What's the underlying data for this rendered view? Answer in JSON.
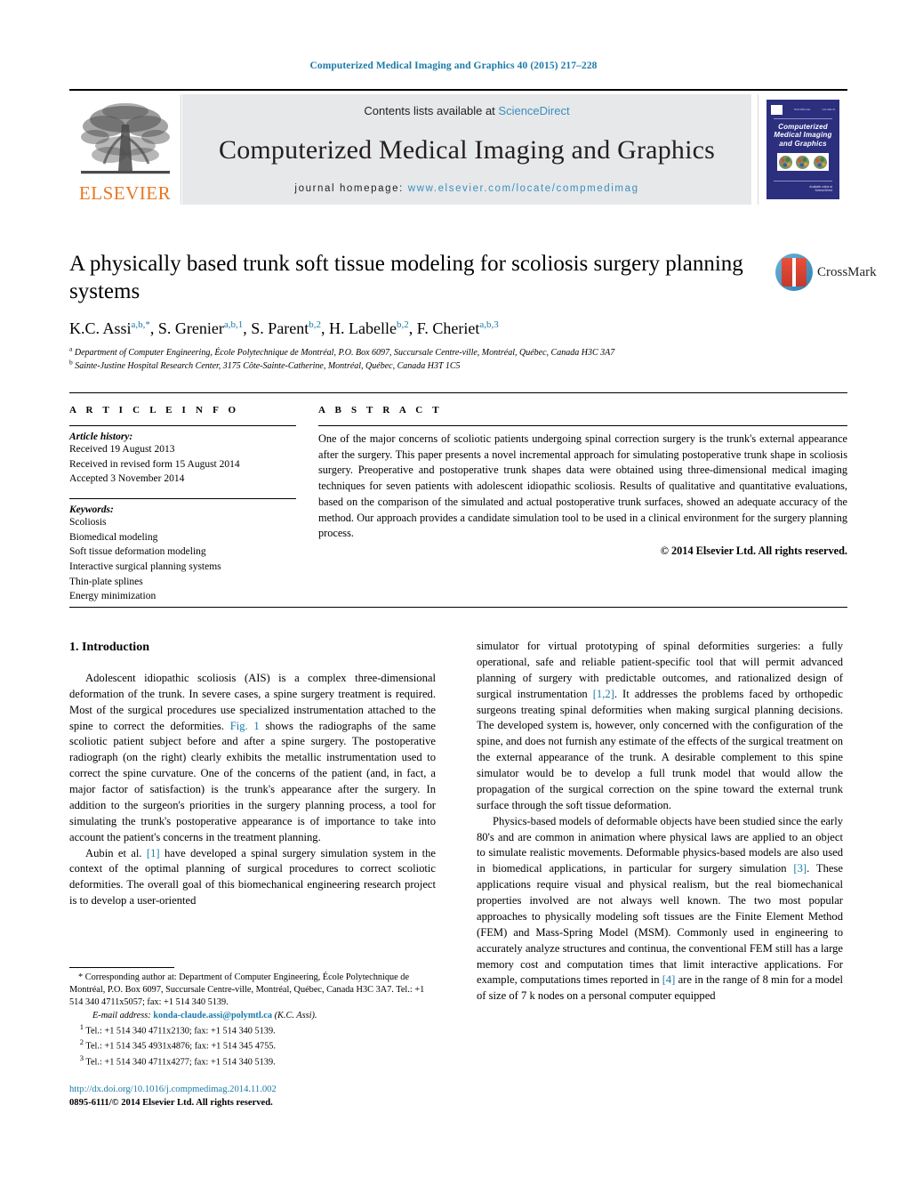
{
  "running_head": "Computerized Medical Imaging and Graphics 40 (2015) 217–228",
  "masthead": {
    "publisher_name": "ELSEVIER",
    "publisher_logo": "elsevier-tree-logo",
    "contents_prefix": "Contents lists available at ",
    "contents_link": "ScienceDirect",
    "journal_title": "Computerized Medical Imaging and Graphics",
    "homepage_label": "journal homepage:",
    "homepage_url": "www.elsevier.com/locate/compmedimag",
    "cover": {
      "title_lines": [
        "Computerized",
        "Medical Imaging",
        "and Graphics"
      ],
      "header_left": "ISSN 0895-6111",
      "header_right": "VOLUME 40",
      "footer": "Available online at\\nScienceDirect"
    }
  },
  "article": {
    "title": "A physically based trunk soft tissue modeling for scoliosis surgery planning systems",
    "authors": [
      {
        "name": "K.C. Assi",
        "sup": "a,b,*"
      },
      {
        "name": "S. Grenier",
        "sup": "a,b,1"
      },
      {
        "name": "S. Parent",
        "sup": "b,2"
      },
      {
        "name": "H. Labelle",
        "sup": "b,2"
      },
      {
        "name": "F. Cheriet",
        "sup": "a,b,3"
      }
    ],
    "affiliations": [
      {
        "mark": "a",
        "text": "Department of Computer Engineering, École Polytechnique de Montréal, P.O. Box 6097, Succursale Centre-ville, Montréal, Québec, Canada H3C 3A7"
      },
      {
        "mark": "b",
        "text": "Sainte-Justine Hospital Research Center, 3175 Côte-Sainte-Catherine, Montréal, Québec, Canada H3T 1C5"
      }
    ],
    "crossmark_label": "CrossMark"
  },
  "info": {
    "heading": "A R T I C L E    I N F O",
    "history_label": "Article history:",
    "history": [
      "Received 19 August 2013",
      "Received in revised form 15 August 2014",
      "Accepted 3 November 2014"
    ],
    "keywords_label": "Keywords:",
    "keywords": [
      "Scoliosis",
      "Biomedical modeling",
      "Soft tissue deformation modeling",
      "Interactive surgical planning systems",
      "Thin-plate splines",
      "Energy minimization"
    ]
  },
  "abstract": {
    "heading": "A B S T R A C T",
    "text": "One of the major concerns of scoliotic patients undergoing spinal correction surgery is the trunk's external appearance after the surgery. This paper presents a novel incremental approach for simulating postoperative trunk shape in scoliosis surgery. Preoperative and postoperative trunk shapes data were obtained using three-dimensional medical imaging techniques for seven patients with adolescent idiopathic scoliosis. Results of qualitative and quantitative evaluations, based on the comparison of the simulated and actual postoperative trunk surfaces, showed an adequate accuracy of the method. Our approach provides a candidate simulation tool to be used in a clinical environment for the surgery planning process.",
    "copyright": "© 2014 Elsevier Ltd. All rights reserved."
  },
  "body": {
    "section_heading": "1. Introduction",
    "left_paragraphs": [
      {
        "parts": [
          {
            "t": "Adolescent idiopathic scoliosis (AIS) is a complex three-dimensional deformation of the trunk. In severe cases, a spine surgery treatment is required. Most of the surgical procedures use specialized instrumentation attached to the spine to correct the deformities. "
          },
          {
            "t": "Fig. 1",
            "link": true
          },
          {
            "t": " shows the radiographs of the same scoliotic patient subject before and after a spine surgery. The postoperative radiograph (on the right) clearly exhibits the metallic instrumentation used to correct the spine curvature. One of the concerns of the patient (and, in fact, a major factor of satisfaction) is the trunk's appearance after the surgery. In addition to the surgeon's priorities in the surgery planning process, a tool for simulating the trunk's postoperative appearance is of importance to take into account the patient's concerns in the treatment planning."
          }
        ]
      },
      {
        "parts": [
          {
            "t": "Aubin et al. "
          },
          {
            "t": "[1]",
            "link": true
          },
          {
            "t": " have developed a spinal surgery simulation system in the context of the optimal planning of surgical procedures to correct scoliotic deformities. The overall goal of this biomechanical engineering research project is to develop a user-oriented"
          }
        ]
      }
    ],
    "right_paragraphs": [
      {
        "noindent": true,
        "parts": [
          {
            "t": "simulator for virtual prototyping of spinal deformities surgeries: a fully operational, safe and reliable patient-specific tool that will permit advanced planning of surgery with predictable outcomes, and rationalized design of surgical instrumentation "
          },
          {
            "t": "[1,2]",
            "link": true
          },
          {
            "t": ". It addresses the problems faced by orthopedic surgeons treating spinal deformities when making surgical planning decisions. The developed system is, however, only concerned with the configuration of the spine, and does not furnish any estimate of the effects of the surgical treatment on the external appearance of the trunk. A desirable complement to this spine simulator would be to develop a full trunk model that would allow the propagation of the surgical correction on the spine toward the external trunk surface through the soft tissue deformation."
          }
        ]
      },
      {
        "parts": [
          {
            "t": "Physics-based models of deformable objects have been studied since the early 80's and are common in animation where physical laws are applied to an object to simulate realistic movements. Deformable physics-based models are also used in biomedical applications, in particular for surgery simulation "
          },
          {
            "t": "[3]",
            "link": true
          },
          {
            "t": ". These applications require visual and physical realism, but the real biomechanical properties involved are not always well known. The two most popular approaches to physically modeling soft tissues are the Finite Element Method (FEM) and Mass-Spring Model (MSM). Commonly used in engineering to accurately analyze structures and continua, the conventional FEM still has a large memory cost and computation times that limit interactive applications. For example, computations times reported in "
          },
          {
            "t": "[4]",
            "link": true
          },
          {
            "t": " are in the range of 8 min for a model of size of 7 k nodes on a personal computer equipped"
          }
        ]
      }
    ]
  },
  "footnotes": {
    "corresponding": "* Corresponding author at: Department of Computer Engineering, École Polytechnique de Montréal, P.O. Box 6097, Succursale Centre-ville, Montréal, Québec, Canada H3C 3A7. Tel.: +1 514 340 4711x5057; fax: +1 514 340 5139.",
    "email_label": "E-mail address:",
    "email": "konda-claude.assi@polymtl.ca",
    "email_owner": "(K.C. Assi).",
    "numbered": [
      {
        "mark": "1",
        "text": "Tel.: +1 514 340 4711x2130; fax: +1 514 340 5139."
      },
      {
        "mark": "2",
        "text": "Tel.: +1 514 345 4931x4876; fax: +1 514 345 4755."
      },
      {
        "mark": "3",
        "text": "Tel.: +1 514 340 4711x4277; fax: +1 514 340 5139."
      }
    ]
  },
  "doi_block": {
    "doi": "http://dx.doi.org/10.1016/j.compmedimag.2014.11.002",
    "issn": "0895-6111/© 2014 Elsevier Ltd. All rights reserved."
  },
  "colors": {
    "link_blue": "#1a7aa8",
    "science_direct_blue": "#3a8fc0",
    "elsevier_orange": "#e87722",
    "band_gray": "#e7e8e9",
    "cover_navy": "#2c2f7e"
  }
}
